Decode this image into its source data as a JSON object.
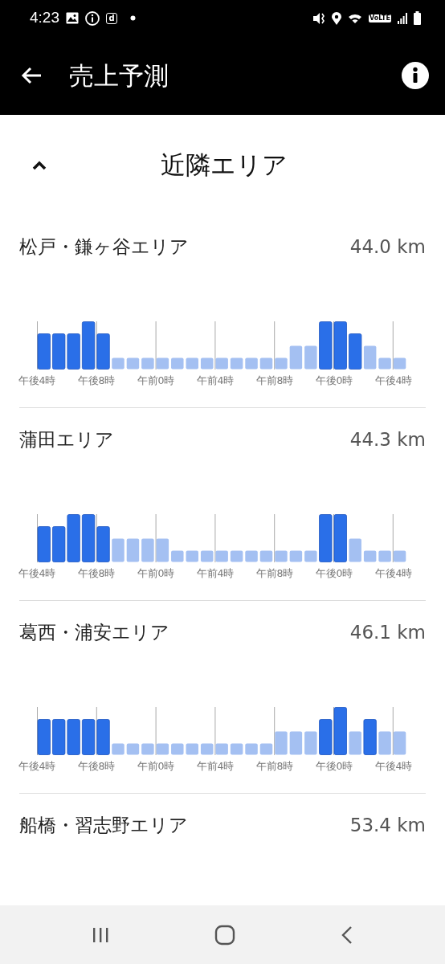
{
  "status_bar": {
    "time": "4:23",
    "app_badge": "d",
    "network": "VoLTE"
  },
  "app_bar": {
    "title": "売上予測"
  },
  "section": {
    "title": "近隣エリア",
    "expanded": true
  },
  "areas": [
    {
      "name": "松戸・鎌ヶ谷エリア",
      "distance": "44.0 km",
      "axis_labels": [
        "午後4時",
        "午後8時",
        "午前0時",
        "午前4時",
        "午前8時",
        "午後0時",
        "午後4時"
      ],
      "bars": [
        {
          "peak": true
        },
        {
          "peak": true
        },
        {
          "peak": true
        },
        {
          "peak": true
        },
        {
          "peak": true
        },
        {
          "peak": false
        },
        {
          "peak": false
        },
        {
          "peak": false
        },
        {
          "peak": false
        },
        {
          "peak": false
        },
        {
          "peak": false
        },
        {
          "peak": false
        },
        {
          "peak": false
        },
        {
          "peak": false
        },
        {
          "peak": false
        },
        {
          "peak": false
        },
        {
          "peak": false
        },
        {
          "peak": false
        },
        {
          "peak": false
        },
        {
          "peak": true
        },
        {
          "peak": true
        },
        {
          "peak": true
        },
        {
          "peak": false
        },
        {
          "peak": false
        },
        {
          "peak": false
        }
      ]
    },
    {
      "name": "蒲田エリア",
      "distance": "44.3 km",
      "axis_labels": [
        "午後4時",
        "午後8時",
        "午前0時",
        "午前4時",
        "午前8時",
        "午後0時",
        "午後4時"
      ],
      "bars": [
        {
          "peak": true
        },
        {
          "peak": true
        },
        {
          "peak": true
        },
        {
          "peak": true
        },
        {
          "peak": true
        },
        {
          "peak": false
        },
        {
          "peak": false
        },
        {
          "peak": false
        },
        {
          "peak": false
        },
        {
          "peak": false
        },
        {
          "peak": false
        },
        {
          "peak": false
        },
        {
          "peak": false
        },
        {
          "peak": false
        },
        {
          "peak": false
        },
        {
          "peak": false
        },
        {
          "peak": false
        },
        {
          "peak": false
        },
        {
          "peak": false
        },
        {
          "peak": true
        },
        {
          "peak": true
        },
        {
          "peak": false
        },
        {
          "peak": false
        },
        {
          "peak": false
        },
        {
          "peak": false
        }
      ]
    },
    {
      "name": "葛西・浦安エリア",
      "distance": "46.1 km",
      "axis_labels": [
        "午後4時",
        "午後8時",
        "午前0時",
        "午前4時",
        "午前8時",
        "午後0時",
        "午後4時"
      ],
      "bars": [
        {
          "peak": true
        },
        {
          "peak": true
        },
        {
          "peak": true
        },
        {
          "peak": true
        },
        {
          "peak": true
        },
        {
          "peak": false
        },
        {
          "peak": false
        },
        {
          "peak": false
        },
        {
          "peak": false
        },
        {
          "peak": false
        },
        {
          "peak": false
        },
        {
          "peak": false
        },
        {
          "peak": false
        },
        {
          "peak": false
        },
        {
          "peak": false
        },
        {
          "peak": false
        },
        {
          "peak": false
        },
        {
          "peak": false
        },
        {
          "peak": false
        },
        {
          "peak": true
        },
        {
          "peak": true
        },
        {
          "peak": false
        },
        {
          "peak": true
        },
        {
          "peak": false
        },
        {
          "peak": false
        }
      ]
    },
    {
      "name": "船橋・習志野エリア",
      "distance": "53.4 km"
    }
  ]
}
